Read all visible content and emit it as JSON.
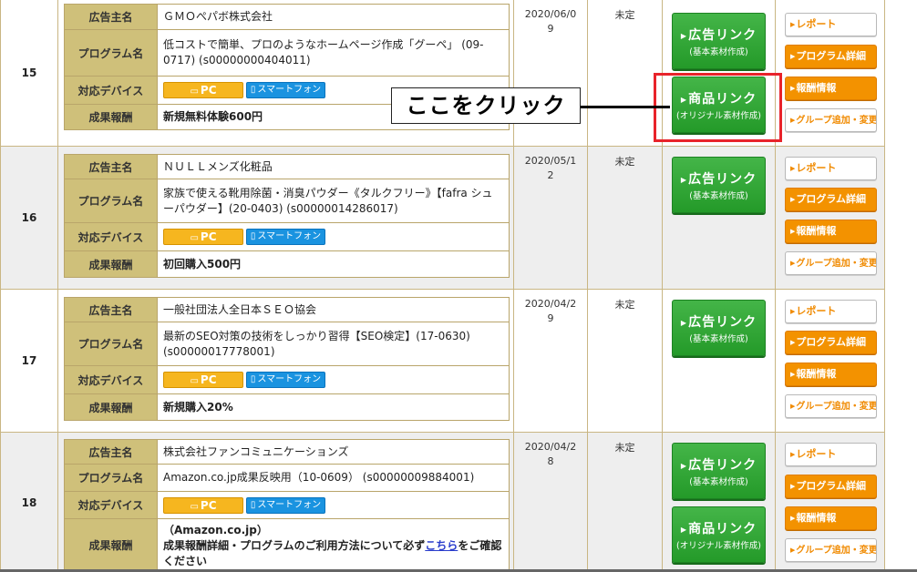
{
  "labels": {
    "advertiser": "広告主名",
    "program": "プログラム名",
    "device": "対応デバイス",
    "reward": "成果報酬"
  },
  "devices": {
    "pc": "PC",
    "smartphone": "スマートフォン"
  },
  "buttons": {
    "ad_link": "広告リンク",
    "ad_link_sub": "(基本素材作成)",
    "product_link": "商品リンク",
    "product_link_sub": "(オリジナル素材作成)",
    "report": "レポート",
    "program_detail": "プログラム詳細",
    "reward_info": "報酬情報",
    "group_add": "グループ追加・変更"
  },
  "annotation": {
    "callout": "ここをクリック"
  },
  "rows": [
    {
      "num": "15",
      "advertiser": "ＧＭＯぺパボ株式会社",
      "program": "低コストで簡単、プロのようなホームページ作成「グーペ」 (09-0717) (s00000000404011)",
      "reward": "新規無料体験600円",
      "date": "2020/06/09",
      "status": "未定"
    },
    {
      "num": "16",
      "advertiser": "ＮＵＬＬメンズ化粧品",
      "program": "家族で使える靴用除菌・消臭パウダー《タルクフリー》【fafra シューパウダー】(20-0403) (s00000014286017)",
      "reward": "初回購入500円",
      "date": "2020/05/12",
      "status": "未定"
    },
    {
      "num": "17",
      "advertiser": "一般社団法人全日本ＳＥＯ協会",
      "program": "最新のSEO対策の技術をしっかり習得【SEO検定】(17-0630) (s00000017778001)",
      "reward": "新規購入20%",
      "date": "2020/04/29",
      "status": "未定"
    },
    {
      "num": "18",
      "advertiser": "株式会社ファンコミュニケーションズ",
      "program": "Amazon.co.jp成果反映用（10-0609） (s00000009884001)",
      "reward_line1": "（Amazon.co.jp）",
      "reward_line2_a": "成果報酬詳細・プログラムのご利用方法について必ず",
      "reward_link": "こちら",
      "reward_line2_b": "をご確認ください",
      "date": "2020/04/28",
      "status": "未定"
    }
  ]
}
